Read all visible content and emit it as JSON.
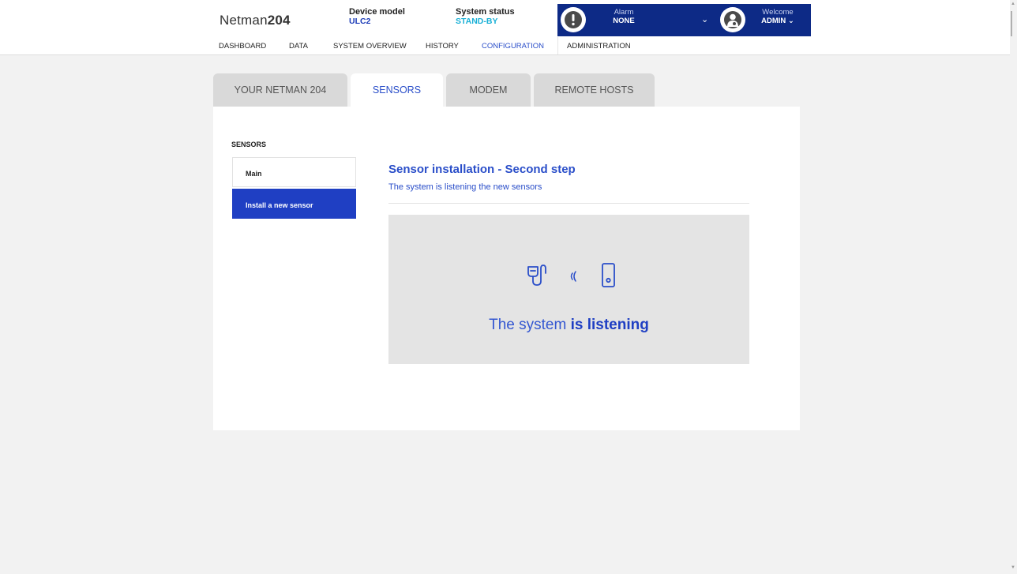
{
  "header": {
    "logo_prefix": "Netman",
    "logo_suffix": "204",
    "device_model_label": "Device model",
    "device_model_value": "ULC2",
    "system_status_label": "System status",
    "system_status_value": "STAND-BY",
    "alarm_label": "Alarm",
    "alarm_value": "NONE",
    "welcome_label": "Welcome",
    "welcome_user": "ADMIN"
  },
  "nav": {
    "items": [
      "DASHBOARD",
      "DATA",
      "SYSTEM OVERVIEW",
      "HISTORY",
      "CONFIGURATION",
      "ADMINISTRATION"
    ],
    "active": "CONFIGURATION"
  },
  "tabs": [
    "YOUR NETMAN 204",
    "SENSORS",
    "MODEM",
    "REMOTE HOSTS"
  ],
  "active_tab": "SENSORS",
  "sidebar": {
    "title": "SENSORS",
    "items": [
      "Main",
      "Install a new sensor"
    ],
    "active": "Install a new sensor"
  },
  "content": {
    "title": "Sensor installation - Second step",
    "subtitle": "The system is listening the new sensors",
    "status_prefix": "The system ",
    "status_strong": "is listening"
  },
  "icons": {
    "alarm": "alert-bubble-icon",
    "user": "user-avatar-icon",
    "sensor": "sensor-probe-icon",
    "signal": "wireless-signal-icon",
    "device": "device-icon",
    "dropdown": "chevron-down-icon"
  },
  "colors": {
    "accent": "#2a4ec9",
    "header_dark": "#0d2a86",
    "status_cyan": "#1ab0d6",
    "active_item": "#1f3fc3"
  }
}
